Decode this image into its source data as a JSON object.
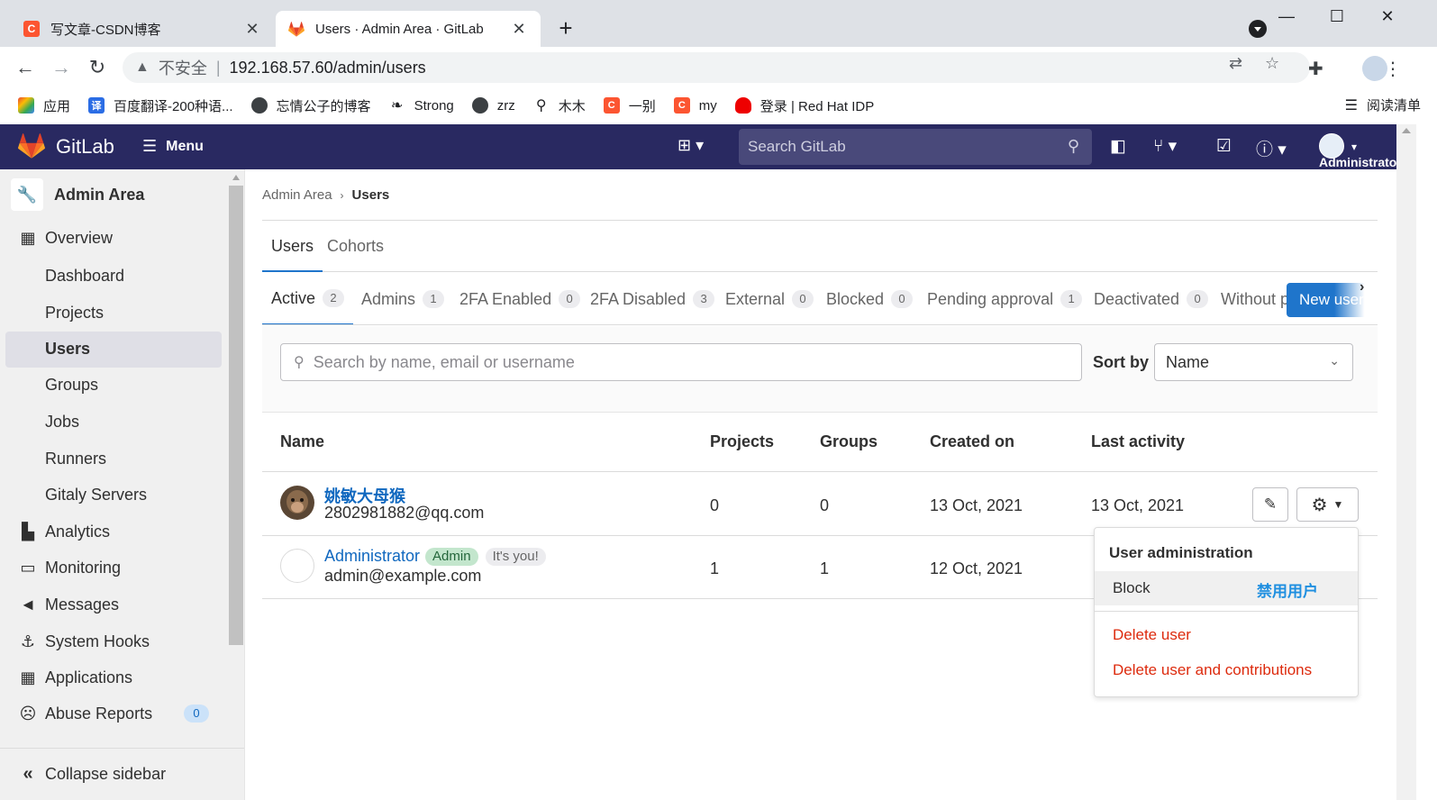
{
  "browser": {
    "tabs": [
      {
        "title": "写文章-CSDN博客",
        "icon": "csdn-icon",
        "color": "#fc5531"
      },
      {
        "title": "Users · Admin Area · GitLab",
        "icon": "gitlab-icon",
        "color": "#e24329"
      }
    ],
    "url_warning": "不安全",
    "url": "192.168.57.60/admin/users",
    "bookmarks": [
      {
        "label": "应用",
        "icon": "apps-grid-icon"
      },
      {
        "label": "百度翻译-200种语...",
        "icon": "baidu-translate-icon"
      },
      {
        "label": "忘情公子的博客",
        "icon": "globe-icon"
      },
      {
        "label": "Strong",
        "icon": "bird-icon"
      },
      {
        "label": "zrz",
        "icon": "globe-icon"
      },
      {
        "label": "木木",
        "icon": "figure-icon"
      },
      {
        "label": "一别",
        "icon": "csdn-icon"
      },
      {
        "label": "my",
        "icon": "csdn-icon"
      },
      {
        "label": "登录 | Red Hat IDP",
        "icon": "redhat-icon"
      }
    ],
    "reading_list": "阅读清单"
  },
  "header": {
    "brand": "GitLab",
    "menu_label": "Menu",
    "search_placeholder": "Search GitLab",
    "username": "Administrator",
    "bg_color": "#292961"
  },
  "sidebar": {
    "context_title": "Admin Area",
    "overview": "Overview",
    "overview_items": [
      "Dashboard",
      "Projects",
      "Users",
      "Groups",
      "Jobs",
      "Runners",
      "Gitaly Servers"
    ],
    "active_item": "Users",
    "sections": [
      {
        "label": "Analytics",
        "icon": "chart-icon"
      },
      {
        "label": "Monitoring",
        "icon": "monitor-icon"
      },
      {
        "label": "Messages",
        "icon": "megaphone-icon"
      },
      {
        "label": "System Hooks",
        "icon": "hook-icon"
      },
      {
        "label": "Applications",
        "icon": "applications-icon"
      },
      {
        "label": "Abuse Reports",
        "icon": "abuse-icon",
        "badge": "0"
      }
    ],
    "collapse_label": "Collapse sidebar"
  },
  "breadcrumb": {
    "parent": "Admin Area",
    "current": "Users"
  },
  "top_tabs": {
    "users": "Users",
    "cohorts": "Cohorts"
  },
  "filter_tabs": [
    {
      "label": "Active",
      "count": "2"
    },
    {
      "label": "Admins",
      "count": "1"
    },
    {
      "label": "2FA Enabled",
      "count": "0"
    },
    {
      "label": "2FA Disabled",
      "count": "3"
    },
    {
      "label": "External",
      "count": "0"
    },
    {
      "label": "Blocked",
      "count": "0"
    },
    {
      "label": "Pending approval",
      "count": "1"
    },
    {
      "label": "Deactivated",
      "count": "0"
    },
    {
      "label": "Without projects",
      "count": ""
    }
  ],
  "new_user_button": "New user",
  "search": {
    "placeholder": "Search by name, email or username"
  },
  "sort": {
    "label": "Sort by",
    "value": "Name"
  },
  "table": {
    "headers": {
      "name": "Name",
      "projects": "Projects",
      "groups": "Groups",
      "created": "Created on",
      "last_activity": "Last activity"
    },
    "rows": [
      {
        "name": "姚敏大母猴",
        "email": "2802981882@qq.com",
        "projects": "0",
        "groups": "0",
        "created": "13 Oct, 2021",
        "last_activity": "13 Oct, 2021"
      },
      {
        "name": "Administrator",
        "badge": "Admin",
        "you_badge": "It's you!",
        "email": "admin@example.com",
        "projects": "1",
        "groups": "1",
        "created": "12 Oct, 2021",
        "last_activity": ""
      }
    ]
  },
  "dropdown": {
    "header": "User administration",
    "block": "Block",
    "annotation": "禁用用户",
    "delete_user": "Delete user",
    "delete_user_contrib": "Delete user and contributions"
  },
  "colors": {
    "primary": "#1f75cb",
    "danger": "#dd2b0e",
    "link": "#1068bf"
  }
}
